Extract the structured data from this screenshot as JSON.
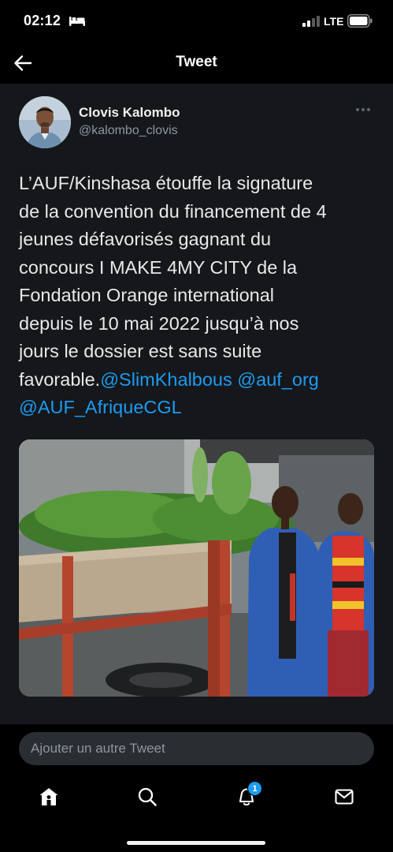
{
  "status_bar": {
    "time": "02:12",
    "network": "LTE",
    "icons": [
      "bed-icon",
      "signal-icon",
      "battery-icon"
    ]
  },
  "header": {
    "title": "Tweet",
    "back_icon": "arrow-left-icon"
  },
  "tweet": {
    "author": {
      "name": "Clovis Kalombo",
      "handle": "@kalombo_clovis"
    },
    "more_icon": "more-dots-icon",
    "text_lines": [
      "L’AUF/Kinshasa étouffe la signature",
      "de la convention du financement de 4",
      "jeunes défavorisés gagnant du",
      "concours I MAKE 4MY CITY de la",
      "Fondation Orange international",
      "depuis le 10 mai 2022 jusqu’à nos",
      "jours le dossier est sans suite"
    ],
    "last_line_text": "favorable.",
    "mentions": [
      "@SlimKhalbous",
      "@auf_org",
      "@AUF_AfriqueCGL"
    ],
    "media": "photo"
  },
  "compose": {
    "placeholder": "Ajouter un autre Tweet"
  },
  "tab_bar": {
    "items": [
      {
        "name": "home",
        "icon": "home-icon"
      },
      {
        "name": "search",
        "icon": "search-icon"
      },
      {
        "name": "notifications",
        "icon": "bell-icon",
        "badge": "1"
      },
      {
        "name": "messages",
        "icon": "mail-icon"
      }
    ]
  },
  "colors": {
    "accent": "#1d9bf0",
    "background": "#000000",
    "tweet_background": "#15171a",
    "text": "#e7e9ea",
    "secondary_text": "#8b98a5"
  }
}
